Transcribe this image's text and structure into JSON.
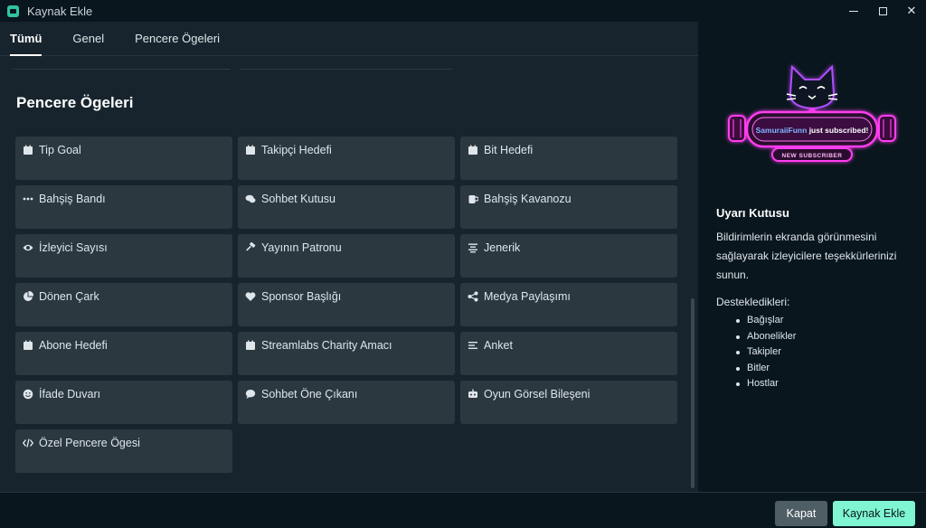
{
  "window": {
    "title": "Kaynak Ekle"
  },
  "tabs": [
    {
      "label": "Tümü"
    },
    {
      "label": "Genel"
    },
    {
      "label": "Pencere Ögeleri"
    }
  ],
  "section": {
    "title": "Pencere Ögeleri"
  },
  "cards": [
    {
      "label": "Tip Goal",
      "icon": "calendar-icon"
    },
    {
      "label": "Takipçi Hedefi",
      "icon": "calendar-icon"
    },
    {
      "label": "Bit Hedefi",
      "icon": "calendar-icon"
    },
    {
      "label": "Bahşiş Bandı",
      "icon": "dots-icon"
    },
    {
      "label": "Sohbet Kutusu",
      "icon": "chat-icon"
    },
    {
      "label": "Bahşiş Kavanozu",
      "icon": "jar-icon"
    },
    {
      "label": "İzleyici Sayısı",
      "icon": "eye-icon"
    },
    {
      "label": "Yayının Patronu",
      "icon": "hammer-icon"
    },
    {
      "label": "Jenerik",
      "icon": "align-icon"
    },
    {
      "label": "Dönen Çark",
      "icon": "pie-icon"
    },
    {
      "label": "Sponsor Başlığı",
      "icon": "heart-icon"
    },
    {
      "label": "Medya Paylaşımı",
      "icon": "share-icon"
    },
    {
      "label": "Abone Hedefi",
      "icon": "calendar-icon"
    },
    {
      "label": "Streamlabs Charity Amacı",
      "icon": "calendar-icon"
    },
    {
      "label": "Anket",
      "icon": "list-icon"
    },
    {
      "label": "İfade Duvarı",
      "icon": "smile-icon"
    },
    {
      "label": "Sohbet Öne Çıkanı",
      "icon": "bubble-icon"
    },
    {
      "label": "Oyun Görsel Bileşeni",
      "icon": "game-icon"
    },
    {
      "label": "Özel Pencere Ögesi",
      "icon": "code-icon"
    }
  ],
  "info": {
    "preview": {
      "name": "SamuraiiFunn",
      "message": " just subscribed!",
      "badge": "NEW SUBSCRIBER"
    },
    "title": "Uyarı Kutusu",
    "description": "Bildirimlerin ekranda görünmesini sağlayarak izleyicilere teşekkürlerinizi sunun.",
    "supports_title": "Destekledikleri:",
    "supports": [
      "Bağışlar",
      "Abonelikler",
      "Takipler",
      "Bitler",
      "Hostlar"
    ]
  },
  "footer": {
    "close_label": "Kapat",
    "add_label": "Kaynak Ekle"
  },
  "colors": {
    "accent": "#80f5d2",
    "neon_pink": "#ff3df0",
    "neon_purple": "#b14dff"
  }
}
